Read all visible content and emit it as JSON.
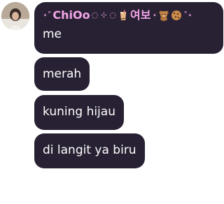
{
  "sender": {
    "name_prefix": "⋆˚",
    "name": "ChiOo",
    "deco_middle": "◌ ⊹ ◌",
    "name_korean": "여보",
    "name_suffix": "˚⋆"
  },
  "messages": [
    {
      "text": "me"
    },
    {
      "text": "merah"
    },
    {
      "text": "kuning hijau"
    },
    {
      "text": "di langit ya biru"
    }
  ],
  "colors": {
    "bubble": "#282133",
    "sender_name": "#f3a6e8",
    "text": "#ffffff"
  }
}
